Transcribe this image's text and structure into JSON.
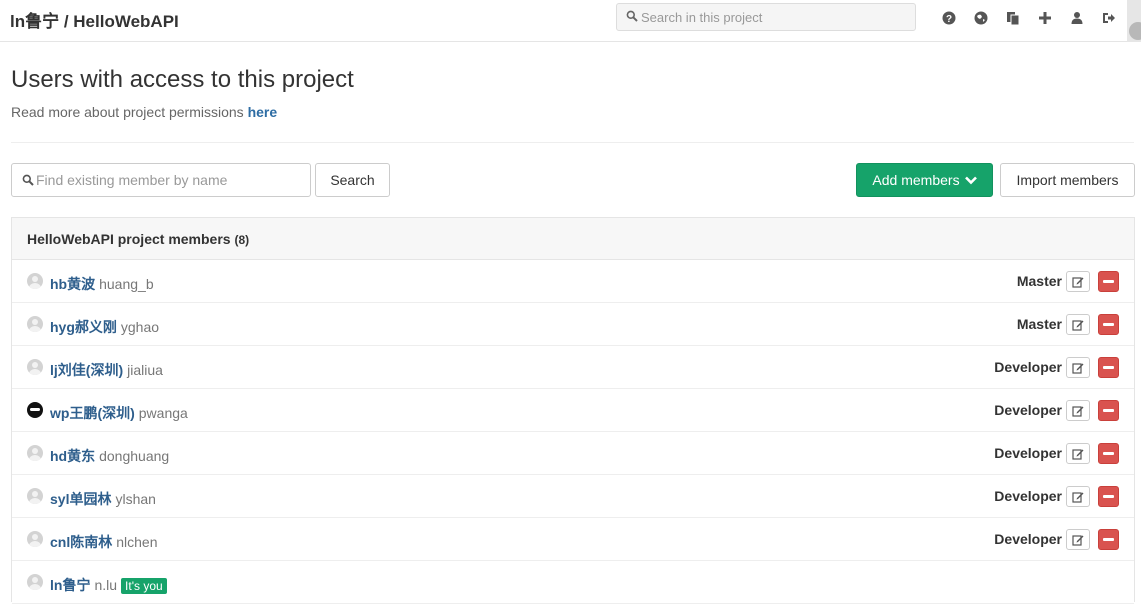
{
  "header": {
    "title": "ln鲁宁 / HelloWebAPI",
    "search_placeholder": "Search in this project",
    "icons": [
      "help-icon",
      "explore-icon",
      "snippets-icon",
      "new-icon",
      "profile-icon",
      "sign-out-icon"
    ]
  },
  "page": {
    "heading": "Users with access to this project",
    "permissions_text": "Read more about project permissions",
    "permissions_link": "here"
  },
  "filter": {
    "placeholder": "Find existing member by name",
    "search_label": "Search",
    "add_label": "Add members",
    "import_label": "Import members"
  },
  "members_panel": {
    "title": "HelloWebAPI project members",
    "count": "(8)",
    "members": [
      {
        "name": "hb黄波",
        "username": "huang_b",
        "role": "Master",
        "avatar": "default"
      },
      {
        "name": "hyg郝义刚",
        "username": "yghao",
        "role": "Master",
        "avatar": "default"
      },
      {
        "name": "lj刘佳(深圳)",
        "username": "jialiua",
        "role": "Developer",
        "avatar": "default"
      },
      {
        "name": "wp王鹏(深圳)",
        "username": "pwanga",
        "role": "Developer",
        "avatar": "dark"
      },
      {
        "name": "hd黄东",
        "username": "donghuang",
        "role": "Developer",
        "avatar": "default"
      },
      {
        "name": "syl单园林",
        "username": "ylshan",
        "role": "Developer",
        "avatar": "default"
      },
      {
        "name": "cnl陈南林",
        "username": "nlchen",
        "role": "Developer",
        "avatar": "default"
      },
      {
        "name": "ln鲁宁",
        "username": "n.lu",
        "role": "",
        "avatar": "default",
        "badge": "It's you"
      }
    ]
  },
  "colors": {
    "link": "#2e5e8c",
    "primary": "#16a36a",
    "danger": "#d9534f"
  }
}
